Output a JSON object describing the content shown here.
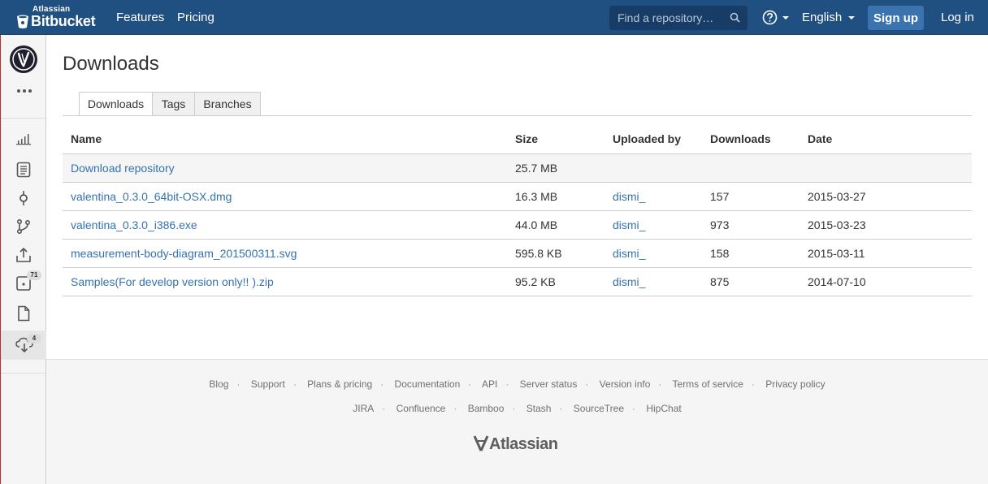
{
  "header": {
    "brand_small": "Atlassian",
    "brand_name": "Bitbucket",
    "nav": [
      "Features",
      "Pricing"
    ],
    "search_placeholder": "Find a repository…",
    "language": "English",
    "signup_label": "Sign up",
    "login_label": "Log in",
    "background": "#205081"
  },
  "sidebar": {
    "badges": {
      "pull_requests": "71",
      "downloads": "4"
    }
  },
  "main": {
    "title": "Downloads",
    "tabs": [
      "Downloads",
      "Tags",
      "Branches"
    ],
    "table": {
      "columns": [
        "Name",
        "Size",
        "Uploaded by",
        "Downloads",
        "Date"
      ],
      "rows": [
        {
          "name": "Download repository",
          "size": "25.7 MB",
          "uploader": "",
          "downloads": "",
          "date": ""
        },
        {
          "name": "valentina_0.3.0_64bit-OSX.dmg",
          "size": "16.3 MB",
          "uploader": "dismi_",
          "downloads": "157",
          "date": "2015-03-27"
        },
        {
          "name": "valentina_0.3.0_i386.exe",
          "size": "44.0 MB",
          "uploader": "dismi_",
          "downloads": "973",
          "date": "2015-03-23"
        },
        {
          "name": "measurement-body-diagram_201500311.svg",
          "size": "595.8 KB",
          "uploader": "dismi_",
          "downloads": "158",
          "date": "2015-03-11"
        },
        {
          "name": "Samples(For develop version only!! ).zip",
          "size": "95.2 KB",
          "uploader": "dismi_",
          "downloads": "875",
          "date": "2014-07-10"
        }
      ]
    }
  },
  "footer": {
    "links_row1": [
      "Blog",
      "Support",
      "Plans & pricing",
      "Documentation",
      "API",
      "Server status",
      "Version info",
      "Terms of service",
      "Privacy policy"
    ],
    "links_row2": [
      "JIRA",
      "Confluence",
      "Bamboo",
      "Stash",
      "SourceTree",
      "HipChat"
    ],
    "logo_text": "Atlassian"
  }
}
